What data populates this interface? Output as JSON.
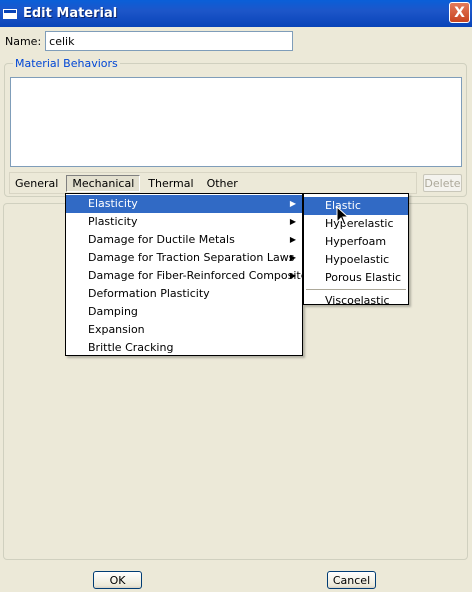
{
  "window": {
    "title": "Edit Material",
    "close_glyph": "X"
  },
  "name_field": {
    "label": "Name:",
    "value": "celik"
  },
  "behaviors": {
    "legend": "Material Behaviors"
  },
  "menubar": {
    "items": [
      {
        "label": "General"
      },
      {
        "label": "Mechanical"
      },
      {
        "label": "Thermal"
      },
      {
        "label": "Other"
      }
    ]
  },
  "delete_button": {
    "label": "Delete"
  },
  "mechanical_menu": {
    "items": [
      {
        "label": "Elasticity",
        "has_submenu": true,
        "selected": true
      },
      {
        "label": "Plasticity",
        "has_submenu": true
      },
      {
        "label": "Damage for Ductile Metals",
        "has_submenu": true
      },
      {
        "label": "Damage for Traction Separation Laws",
        "has_submenu": true
      },
      {
        "label": "Damage for Fiber-Reinforced Composites",
        "has_submenu": true
      },
      {
        "label": "Deformation Plasticity"
      },
      {
        "label": "Damping"
      },
      {
        "label": "Expansion"
      },
      {
        "label": "Brittle Cracking"
      }
    ]
  },
  "elasticity_menu": {
    "items": [
      {
        "label": "Elastic",
        "selected": true
      },
      {
        "label": "Hyperelastic"
      },
      {
        "label": "Hyperfoam"
      },
      {
        "label": "Hypoelastic"
      },
      {
        "label": "Porous Elastic"
      },
      {
        "label": "Viscoelastic"
      }
    ]
  },
  "buttons": {
    "ok": "OK",
    "cancel": "Cancel"
  },
  "colors": {
    "titlebar": "#0a5fd8",
    "selection": "#316ac5",
    "legend": "#0046d5"
  }
}
